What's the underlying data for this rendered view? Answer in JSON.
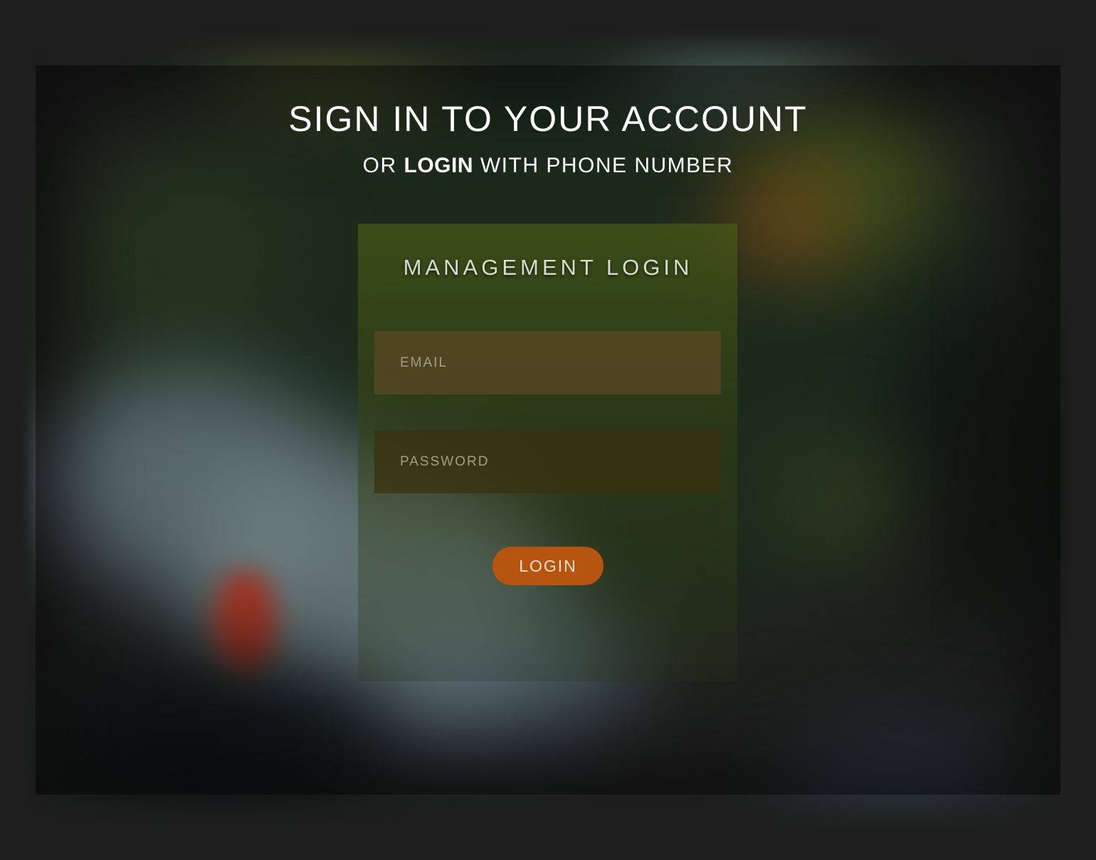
{
  "header": {
    "title": "SIGN IN TO YOUR ACCOUNT",
    "subtitle_prefix": "OR",
    "subtitle_link": "LOGIN",
    "subtitle_suffix": "WITH PHONE NUMBER"
  },
  "login_card": {
    "title": "MANAGEMENT LOGIN",
    "email_placeholder": "EMAIL",
    "password_placeholder": "PASSWORD",
    "submit_label": "LOGIN"
  },
  "colors": {
    "page_frame": "#1e1e1e",
    "card_tint": "#465a16",
    "email_field": "#5c4824",
    "password_field": "#3a300c",
    "button_accent": "#b65510",
    "text": "#ffffff"
  }
}
